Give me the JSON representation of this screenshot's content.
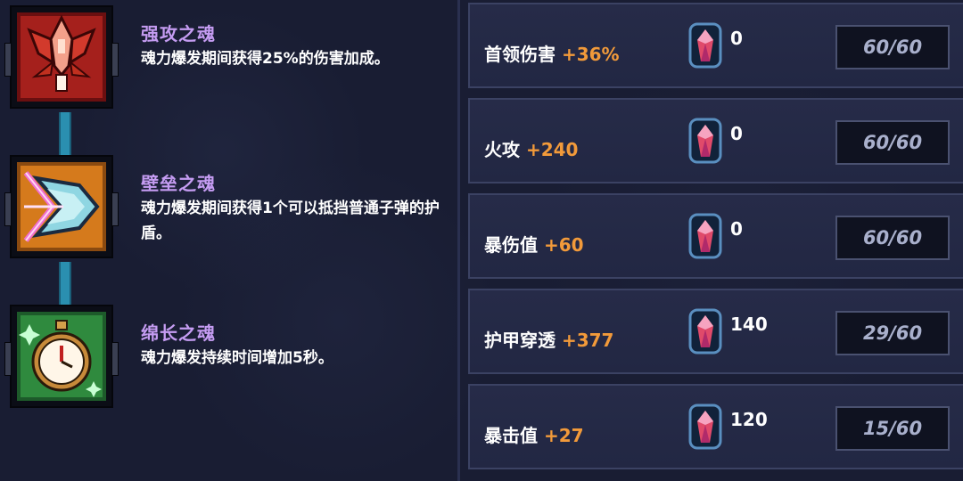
{
  "skills": [
    {
      "title": "强攻之魂",
      "desc": "魂力爆发期间获得25%的伤害加成。",
      "icon": "attack-soul-icon"
    },
    {
      "title": "壁垒之魂",
      "desc": "魂力爆发期间获得1个可以抵挡普通子弹的护盾。",
      "icon": "shield-soul-icon"
    },
    {
      "title": "绵长之魂",
      "desc": "魂力爆发持续时间增加5秒。",
      "icon": "stopwatch-soul-icon"
    }
  ],
  "stats": [
    {
      "name": "首领伤害",
      "bonus": "+36%",
      "gems": "0",
      "progress": "60/60"
    },
    {
      "name": "火攻",
      "bonus": "+240",
      "gems": "0",
      "progress": "60/60"
    },
    {
      "name": "暴伤值",
      "bonus": "+60",
      "gems": "0",
      "progress": "60/60"
    },
    {
      "name": "护甲穿透",
      "bonus": "+377",
      "gems": "140",
      "progress": "29/60"
    },
    {
      "name": "暴击值",
      "bonus": "+27",
      "gems": "120",
      "progress": "15/60"
    }
  ],
  "colors": {
    "accent_purple": "#c59cf2",
    "bonus_orange": "#f29a3a",
    "connector": "#2a8fb0"
  }
}
